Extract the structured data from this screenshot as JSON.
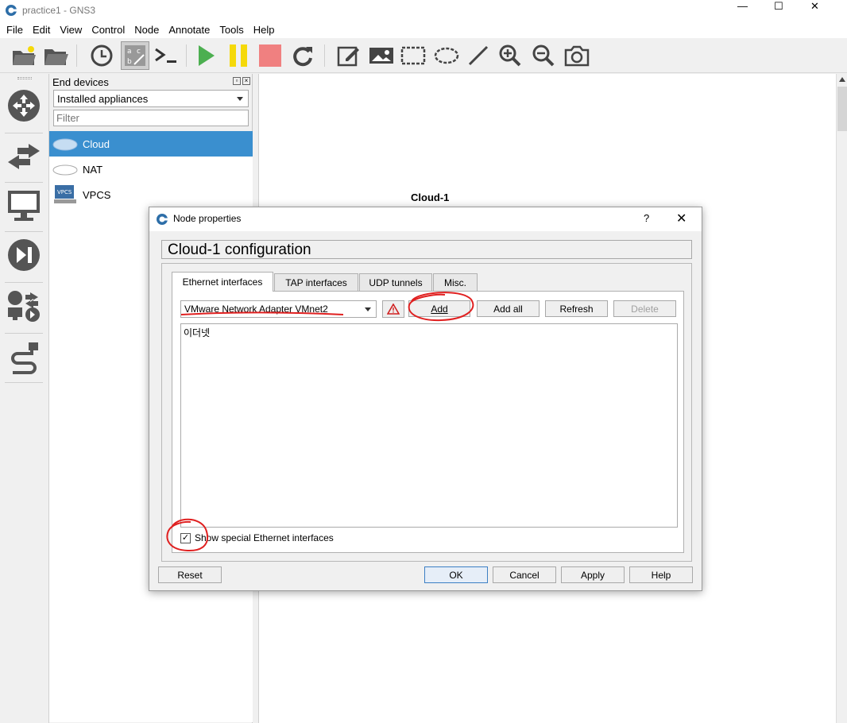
{
  "window": {
    "title": "practice1 - GNS3",
    "minimize": "—",
    "maximize": "☐",
    "close": "✕"
  },
  "menu": [
    "File",
    "Edit",
    "View",
    "Control",
    "Node",
    "Annotate",
    "Tools",
    "Help"
  ],
  "devices_panel": {
    "title": "End devices",
    "appliance_filter": "Installed appliances",
    "filter_placeholder": "Filter",
    "items": [
      {
        "label": "Cloud",
        "selected": true
      },
      {
        "label": "NAT",
        "selected": false
      },
      {
        "label": "VPCS",
        "selected": false,
        "icon_text": "VPCS"
      }
    ]
  },
  "canvas": {
    "node_label": "Cloud-1"
  },
  "dialog": {
    "title": "Node properties",
    "help": "?",
    "close": "✕",
    "header": "Cloud-1 configuration",
    "tabs": [
      "Ethernet interfaces",
      "TAP interfaces",
      "UDP tunnels",
      "Misc."
    ],
    "active_tab": "Ethernet interfaces",
    "interface_selected": "VMware Network Adapter VMnet2",
    "buttons": {
      "add": "Add",
      "add_all": "Add all",
      "refresh": "Refresh",
      "delete": "Delete"
    },
    "interfaces": [
      "이더넷"
    ],
    "show_special_label": "Show special Ethernet interfaces",
    "show_special_checked": "✓",
    "footer": {
      "reset": "Reset",
      "ok": "OK",
      "cancel": "Cancel",
      "apply": "Apply",
      "help": "Help"
    }
  },
  "colors": {
    "selection": "#3a8fcf",
    "annotation_red": "#e02020",
    "start_green": "#4caf50",
    "pause_yellow": "#f5d90a",
    "stop_red": "#f08080"
  }
}
